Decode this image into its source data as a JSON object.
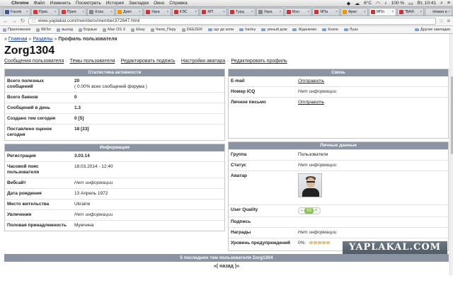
{
  "menubar": {
    "items": [
      "Chrome",
      "Файл",
      "Изменить",
      "Посмотреть",
      "История",
      "Закладки",
      "Окно",
      "Справка"
    ],
    "temp": "6°C",
    "battery": "100 %",
    "clock": "Вт, 10:41"
  },
  "tabs": [
    {
      "title": "Faceb",
      "color": "#3b5998"
    },
    {
      "title": "Прис",
      "color": "#d33"
    },
    {
      "title": "Прия",
      "color": "#d33"
    },
    {
      "title": "Клас",
      "color": "#888"
    },
    {
      "title": "Диет",
      "color": "#e90"
    },
    {
      "title": "Укра",
      "color": "#c33"
    },
    {
      "title": "КЭС",
      "color": "#c33"
    },
    {
      "title": "ЯП",
      "color": "#c33"
    },
    {
      "title": "Турц",
      "color": "#c33"
    },
    {
      "title": "Укра",
      "color": "#888"
    },
    {
      "title": "Мэн",
      "color": "#c33"
    },
    {
      "title": "ЯПа",
      "color": "#c33"
    },
    {
      "title": "Фриг",
      "color": "#e90"
    },
    {
      "title": "ЯПл",
      "color": "#c33"
    },
    {
      "title": "*ВАЯ",
      "color": "#c33"
    },
    {
      "title": "Новая в",
      "color": "#ddd"
    }
  ],
  "toolbar": {
    "url": "www.yaplakal.com/members/member372647.html"
  },
  "bookmarks": {
    "items": [
      "Приложения",
      "BitTor",
      "выход",
      "Борзые",
      "Mac OS X",
      "Ebay",
      "Чили_Перу",
      "DEEZER",
      "що де копи",
      "harley",
      "умный дом",
      "Жданково",
      "Книги",
      "Луаз"
    ],
    "other": "Другие закладки"
  },
  "breadcrumbs": {
    "home": "Главная",
    "sections": "Разделы",
    "current": "Профиль пользователя"
  },
  "profile": {
    "username": "Zorg1304",
    "links": [
      "Сообщения пользователя",
      "Темы пользователя",
      "Редактировать подпись",
      "Настройки аватара",
      "Редактировать профиль"
    ]
  },
  "stats": {
    "header": "Статистика активности",
    "rows": [
      {
        "label": "Всего полезных сообщений",
        "value": "20",
        "sub": "( 0.00% всех сообщений форума )"
      },
      {
        "label": "Всего баянов",
        "value": "0",
        "sub": ""
      },
      {
        "label": "Сообщений в день",
        "value": "1.3",
        "sub": ""
      },
      {
        "label": "Создано тем сегодня",
        "value": "0 [5]",
        "sub": ""
      },
      {
        "label": "Поставлено оценок сегодня",
        "value": "18 [23]",
        "sub": ""
      }
    ]
  },
  "contact": {
    "header": "Связь",
    "rows": [
      {
        "label": "E-mail",
        "value": "Отправить",
        "link": true
      },
      {
        "label": "Номер ICQ",
        "value": "Нет информации",
        "link": false
      },
      {
        "label": "Личное письмо",
        "value": "Отправить",
        "link": true
      }
    ]
  },
  "info": {
    "header": "Информация",
    "rows": [
      {
        "label": "Регистрация",
        "value": "3.03.14",
        "style": "b"
      },
      {
        "label": "Часовой пояс пользователя",
        "value": "18.03.2014 - 12:40",
        "style": ""
      },
      {
        "label": "Вебсайт",
        "value": "Нет информации",
        "style": "it"
      },
      {
        "label": "Дата рождения",
        "value": "13 Апрель 1972",
        "style": ""
      },
      {
        "label": "Место жительства",
        "value": "Ukraine",
        "style": ""
      },
      {
        "label": "Увлечения",
        "value": "Нет информации",
        "style": "it"
      },
      {
        "label": "Половая принадлежность",
        "value": "Мужчина",
        "style": ""
      }
    ]
  },
  "personal": {
    "header": "Личные данные",
    "group_label": "Группа",
    "group_value": "Пользователи",
    "status_label": "Статус",
    "status_value": "Нет информации",
    "avatar_label": "Аватар",
    "uq_label": "User Quality",
    "uq_minus": "–",
    "uq_score": "63",
    "uq_plus": "+",
    "sig_label": "Подпись",
    "awards_label": "Награды",
    "awards_value": "Нет информации",
    "warn_label": "Уровень предупреждений",
    "warn_value": "0%:"
  },
  "bottom": {
    "header": "5 последних тем пользователя Zorg1304",
    "sub": "«( назад )»"
  },
  "watermark": "YAPLAKAL.COM"
}
